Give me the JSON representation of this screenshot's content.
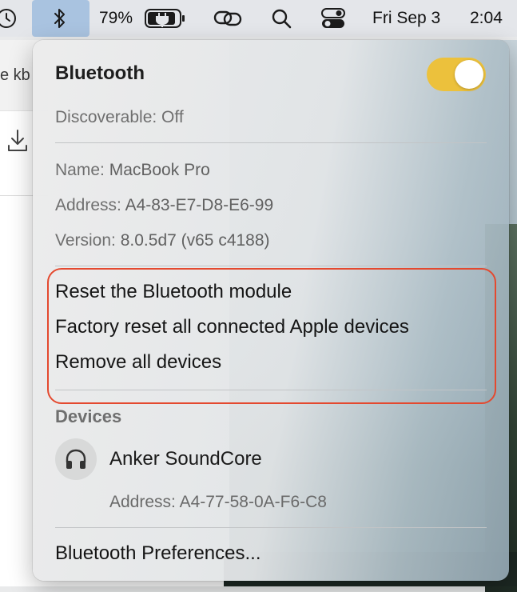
{
  "menubar": {
    "battery_percent": "79%",
    "date": "Fri Sep 3",
    "time": "2:04",
    "icons": [
      "clock-icon",
      "bluetooth-icon",
      "battery-charging-icon",
      "link-icon",
      "search-icon",
      "control-center-icon"
    ]
  },
  "background": {
    "partial_text": "e kb",
    "download_icon": "download-icon"
  },
  "bluetooth_menu": {
    "title": "Bluetooth",
    "toggle_on": true,
    "toggle_color": "#ecc13c",
    "discoverable": "Discoverable: Off",
    "name_label": "Name:",
    "name_value": "MacBook Pro",
    "address_label": "Address:",
    "address_value": "A4-83-E7-D8-E6-99",
    "version_label": "Version:",
    "version_value": "8.0.5d7 (v65 c4188)",
    "actions": [
      "Reset the Bluetooth module",
      "Factory reset all connected Apple devices",
      "Remove all devices"
    ],
    "highlight_color": "#e4492f",
    "devices_header": "Devices",
    "devices": [
      {
        "name": "Anker SoundCore",
        "address_label": "Address:",
        "address": "A4-77-58-0A-F6-C8",
        "icon": "headphones-icon"
      }
    ],
    "preferences": "Bluetooth Preferences..."
  }
}
